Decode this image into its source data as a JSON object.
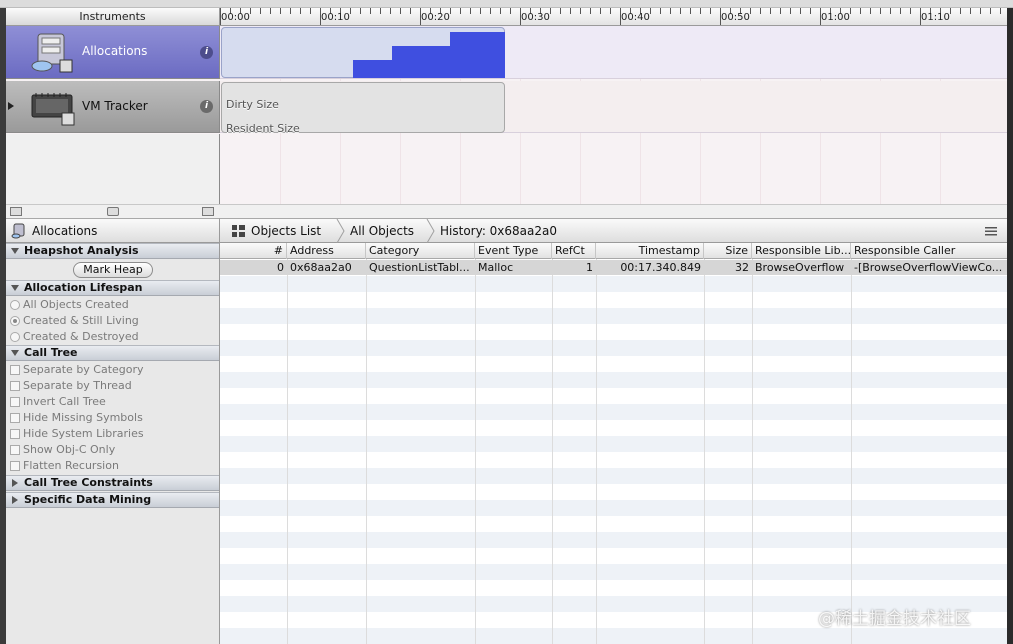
{
  "instruments_header": "Instruments",
  "ruler": [
    "00:00",
    "00:10",
    "00:20",
    "00:30",
    "00:40",
    "00:50",
    "01:00",
    "01:10"
  ],
  "tracks": [
    {
      "name": "Allocations",
      "info": "i",
      "icon": "allocations-instrument-icon"
    },
    {
      "name": "VM Tracker",
      "info": "i",
      "icon": "vm-tracker-instrument-icon",
      "labels": [
        "Dirty Size",
        "Resident Size"
      ]
    }
  ],
  "nav": {
    "instrument": "Allocations",
    "breadcrumbs": [
      "Objects List",
      "All Objects",
      "History: 0x68aa2a0"
    ]
  },
  "sidebar": {
    "heapshot": {
      "title": "Heapshot Analysis",
      "button": "Mark Heap"
    },
    "lifespan": {
      "title": "Allocation Lifespan",
      "options": [
        "All Objects Created",
        "Created & Still Living",
        "Created & Destroyed"
      ],
      "selected": 1
    },
    "call_tree": {
      "title": "Call Tree",
      "options": [
        "Separate by Category",
        "Separate by Thread",
        "Invert Call Tree",
        "Hide Missing Symbols",
        "Hide System Libraries",
        "Show Obj-C Only",
        "Flatten Recursion"
      ]
    },
    "constraints": {
      "title": "Call Tree Constraints"
    },
    "mining": {
      "title": "Specific Data Mining"
    }
  },
  "table": {
    "columns": [
      "#",
      "Address",
      "Category",
      "Event Type",
      "RefCt",
      "Timestamp",
      "Size",
      "Responsible Lib...",
      "Responsible Caller"
    ],
    "rows": [
      [
        "0",
        "0x68aa2a0",
        "QuestionListTabl...",
        "Malloc",
        "1",
        "00:17.340.849",
        "32",
        "BrowseOverflow",
        "-[BrowseOverflowViewCo..."
      ]
    ]
  },
  "watermark": "@稀土掘金技术社区",
  "colors": {
    "allocations_track": "#7474c8",
    "allocation_graph": "#3f4fe0",
    "selected_row": "#d6d6d6",
    "stripe": "#eef2f7"
  }
}
